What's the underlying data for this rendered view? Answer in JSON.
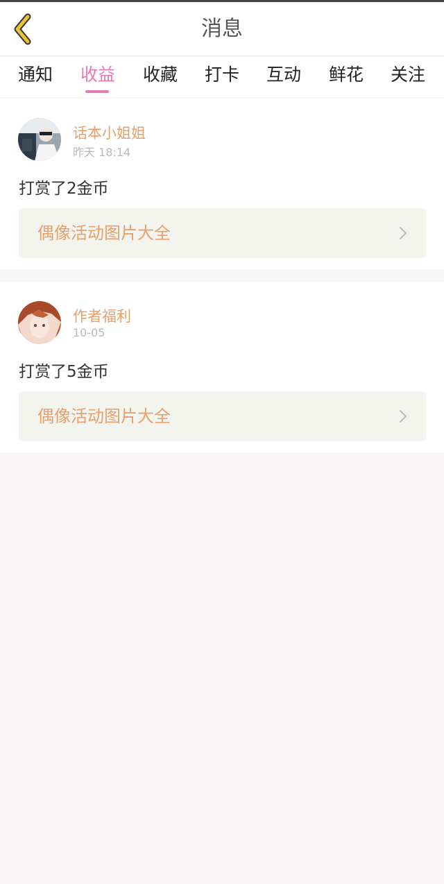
{
  "header": {
    "title": "消息"
  },
  "tabs": [
    {
      "label": "通知",
      "active": false
    },
    {
      "label": "收益",
      "active": true
    },
    {
      "label": "收藏",
      "active": false
    },
    {
      "label": "打卡",
      "active": false
    },
    {
      "label": "互动",
      "active": false
    },
    {
      "label": "鲜花",
      "active": false
    },
    {
      "label": "关注",
      "active": false
    }
  ],
  "messages": [
    {
      "user": "话本小姐姐",
      "time": "昨天 18:14",
      "text": "打赏了2金币",
      "link": "偶像活动图片大全"
    },
    {
      "user": "作者福利",
      "time": "10-05",
      "text": "打赏了5金币",
      "link": "偶像活动图片大全"
    }
  ],
  "colors": {
    "accent": "#e67ab6",
    "name": "#e5a06e",
    "back_icon": "#e8c33a"
  }
}
